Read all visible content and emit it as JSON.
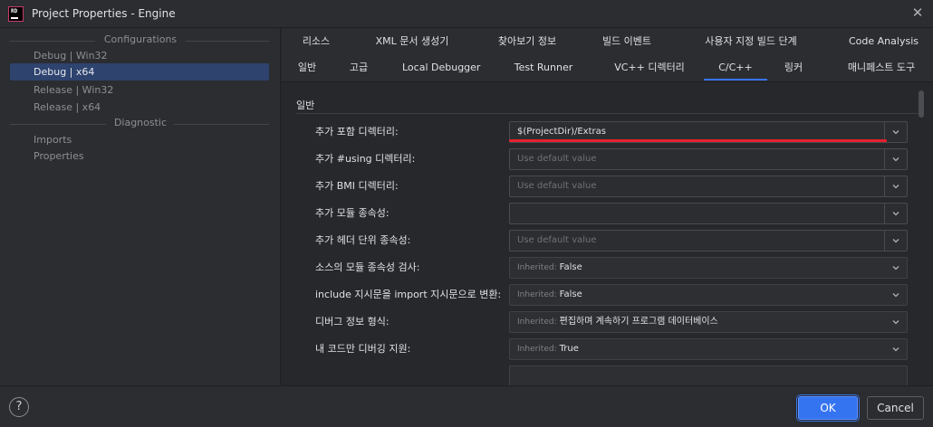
{
  "window": {
    "title": "Project Properties - Engine",
    "icon_text": "RD"
  },
  "sidebar": {
    "groups": [
      {
        "label": "Configurations",
        "items": [
          {
            "label": "Debug | Win32",
            "selected": false
          },
          {
            "label": "Debug | x64",
            "selected": true
          },
          {
            "label": "Release | Win32",
            "selected": false
          },
          {
            "label": "Release | x64",
            "selected": false
          }
        ]
      },
      {
        "label": "Diagnostic",
        "items": [
          {
            "label": "Imports",
            "selected": false
          },
          {
            "label": "Properties",
            "selected": false
          }
        ]
      }
    ]
  },
  "tabs": {
    "row1": [
      "리소스",
      "XML 문서 생성기",
      "찾아보기 정보",
      "빌드 이벤트",
      "사용자 지정 빌드 단계",
      "Code Analysis"
    ],
    "row2": [
      "일반",
      "고급",
      "Local Debugger",
      "Test Runner",
      "VC++ 디렉터리",
      "C/C++",
      "링커",
      "매니페스트 도구"
    ],
    "active": "C/C++"
  },
  "section": {
    "title": "일반"
  },
  "properties": [
    {
      "label": "추가 포함 디렉터리:",
      "kind": "combo",
      "value": "$(ProjectDir)/Extras",
      "placeholder": ""
    },
    {
      "label": "추가 #using 디렉터리:",
      "kind": "combo",
      "value": "",
      "placeholder": "Use default value"
    },
    {
      "label": "추가 BMI 디렉터리:",
      "kind": "combo",
      "value": "",
      "placeholder": "Use default value"
    },
    {
      "label": "추가 모듈 종속성:",
      "kind": "combo",
      "value": "",
      "placeholder": ""
    },
    {
      "label": "추가 헤더 단위 종속성:",
      "kind": "combo",
      "value": "",
      "placeholder": "Use default value"
    },
    {
      "label": "소스의 모듈 종속성 검사:",
      "kind": "select",
      "inherited": "Inherited:",
      "value": "False"
    },
    {
      "label": "include 지시문을 import 지시문으로 변환:",
      "kind": "select",
      "inherited": "Inherited:",
      "value": "False"
    },
    {
      "label": "디버그 정보 형식:",
      "kind": "select",
      "inherited": "Inherited:",
      "value": "편집하며 계속하기 프로그램 데이터베이스"
    },
    {
      "label": "내 코드만 디버깅 지원:",
      "kind": "select",
      "inherited": "Inherited:",
      "value": "True"
    }
  ],
  "footer": {
    "help_label": "?",
    "ok_label": "OK",
    "cancel_label": "Cancel"
  },
  "colors": {
    "accent": "#3574f0",
    "selection": "#2e436e",
    "annotation_red": "#e5202c"
  }
}
